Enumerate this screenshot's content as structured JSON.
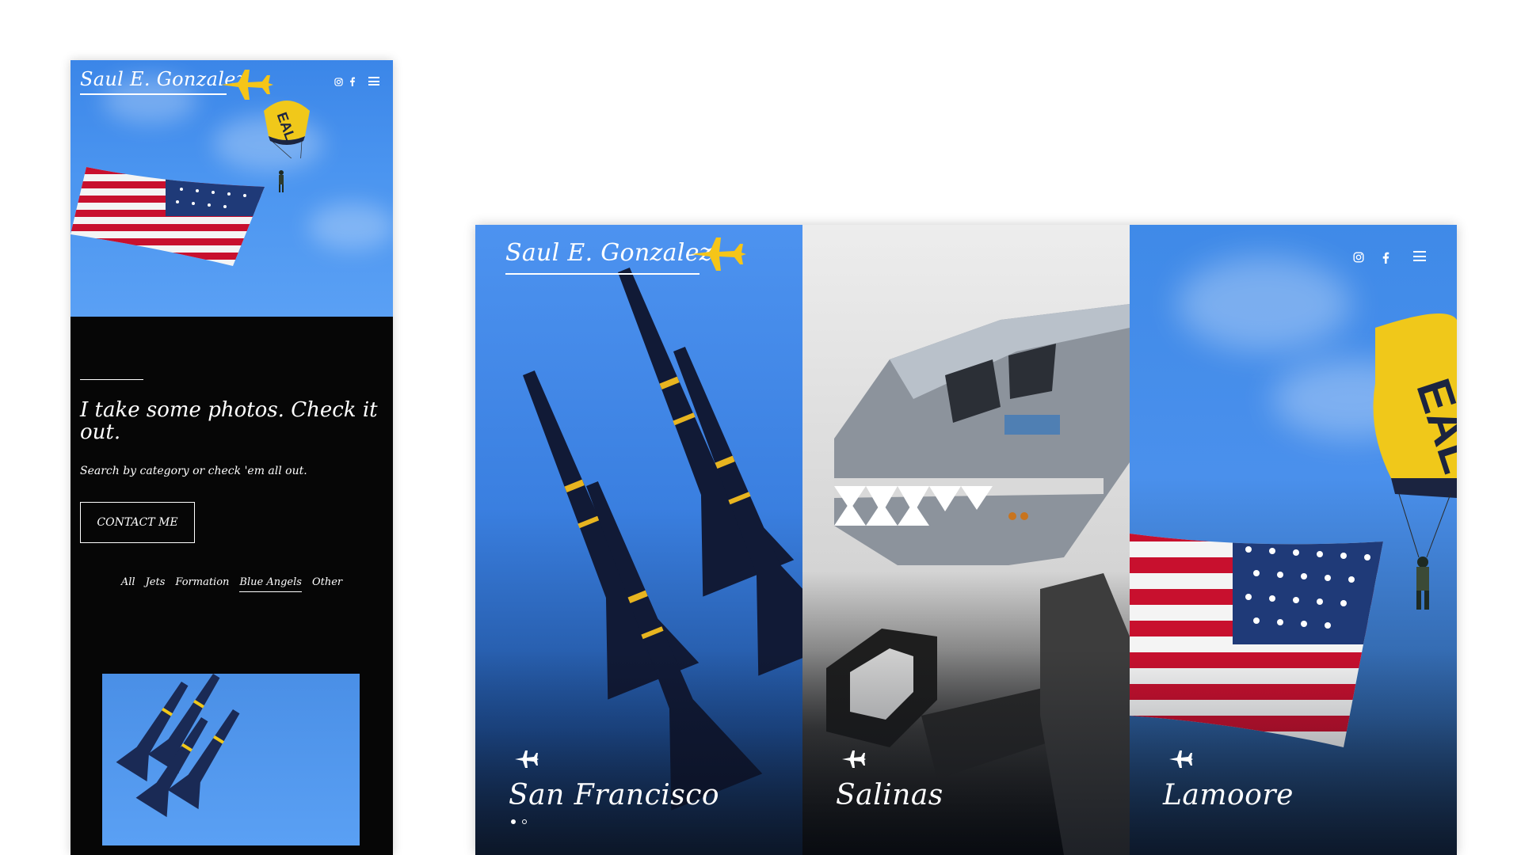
{
  "site": {
    "logo_text": "Saul E. Gonzalez"
  },
  "mobile": {
    "social": {
      "instagram_icon": "instagram-icon",
      "facebook_icon": "facebook-icon",
      "menu_icon": "hamburger-menu-icon"
    },
    "headline": "I take some photos. Check it out.",
    "subheadline": "Search by category or check 'em all out.",
    "contact_label": "CONTACT ME",
    "categories": [
      {
        "label": "All",
        "active": false
      },
      {
        "label": "Jets",
        "active": false
      },
      {
        "label": "Formation",
        "active": false
      },
      {
        "label": "Blue Angels",
        "active": true
      },
      {
        "label": "Other",
        "active": false
      }
    ]
  },
  "desktop": {
    "social": {
      "instagram_icon": "instagram-icon",
      "facebook_icon": "facebook-icon",
      "menu_icon": "hamburger-menu-icon"
    },
    "panels": [
      {
        "label": "San Francisco",
        "icon": "airplane-icon"
      },
      {
        "label": "Salinas",
        "icon": "airplane-icon"
      },
      {
        "label": "Lamoore",
        "icon": "airplane-icon"
      }
    ],
    "carousel": {
      "count": 2,
      "active_index": 0
    }
  },
  "colors": {
    "sky_blue": "#4b95f0",
    "logo_jet_yellow": "#f5c518",
    "dark_bg": "#060606",
    "white": "#ffffff"
  }
}
